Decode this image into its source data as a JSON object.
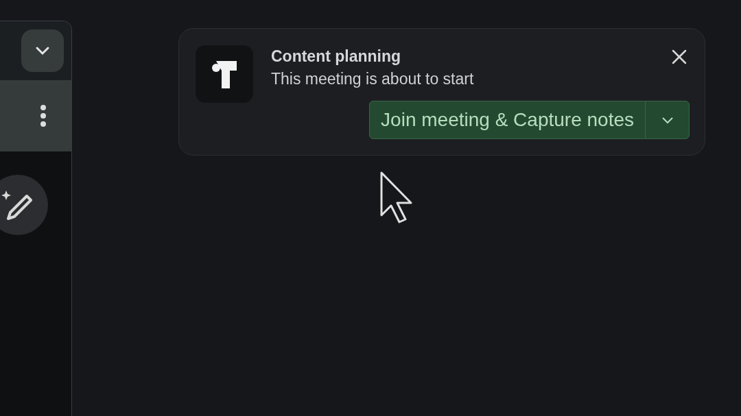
{
  "notification": {
    "title": "Content planning",
    "message": "This meeting is about to start",
    "action": {
      "label": "Join meeting & Capture notes"
    }
  }
}
